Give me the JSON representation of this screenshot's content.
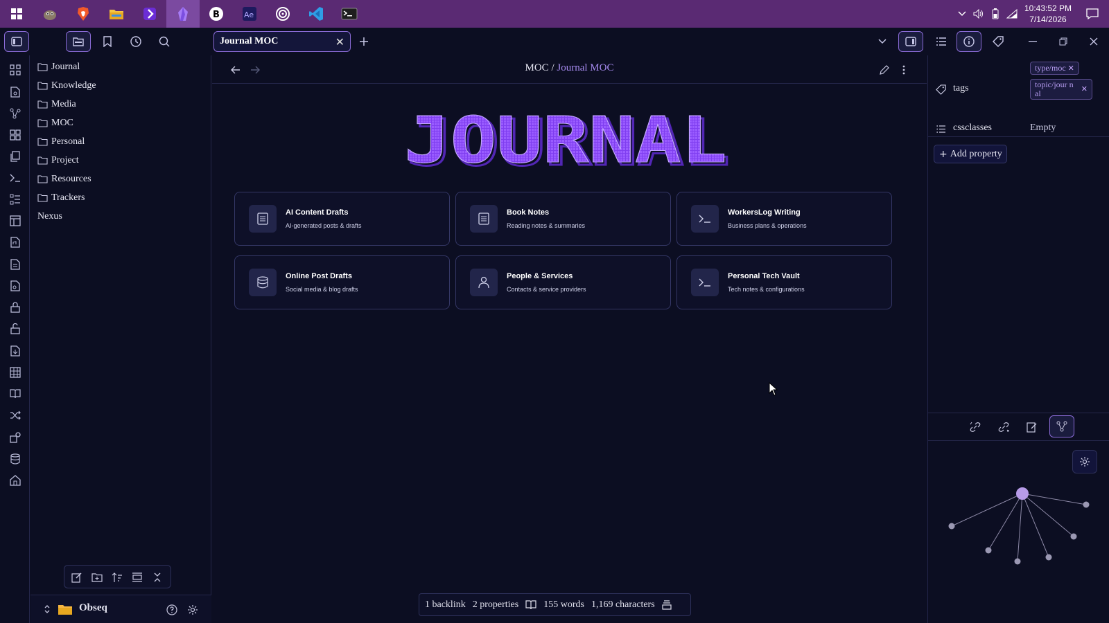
{
  "taskbar": {
    "time": "10:43:52 PM",
    "date": "7/14/2026"
  },
  "tab": {
    "title": "Journal MOC"
  },
  "breadcrumb": {
    "parent": "MOC",
    "sep": " / ",
    "current": "Journal MOC"
  },
  "files": [
    {
      "label": "Journal",
      "type": "folder"
    },
    {
      "label": "Knowledge",
      "type": "folder"
    },
    {
      "label": "Media",
      "type": "folder"
    },
    {
      "label": "MOC",
      "type": "folder"
    },
    {
      "label": "Personal",
      "type": "folder"
    },
    {
      "label": "Project",
      "type": "folder"
    },
    {
      "label": "Resources",
      "type": "folder"
    },
    {
      "label": "Trackers",
      "type": "folder"
    },
    {
      "label": "Nexus",
      "type": "file"
    }
  ],
  "vault": {
    "name": "Obseq"
  },
  "banner": {
    "text": "JOURNAL"
  },
  "cards": [
    {
      "title": "AI Content Drafts",
      "subtitle": "AI-generated posts & drafts",
      "icon": "doc-icon"
    },
    {
      "title": "Book Notes",
      "subtitle": "Reading notes & summaries",
      "icon": "doc-icon"
    },
    {
      "title": "WorkersLog Writing",
      "subtitle": "Business plans & operations",
      "icon": "terminal-icon"
    },
    {
      "title": "Online Post Drafts",
      "subtitle": "Social media & blog drafts",
      "icon": "database-icon"
    },
    {
      "title": "People & Services",
      "subtitle": "Contacts & service providers",
      "icon": "person-icon"
    },
    {
      "title": "Personal Tech Vault",
      "subtitle": "Tech notes & configurations",
      "icon": "terminal-icon"
    }
  ],
  "properties": {
    "tags_label": "tags",
    "tags": [
      "type/moc",
      "topic/jour nal"
    ],
    "cssclasses_label": "cssclasses",
    "cssclasses_value": "Empty",
    "add_label": "Add property"
  },
  "status": {
    "backlinks": "1 backlink",
    "properties": "2 properties",
    "words": "155 words",
    "characters": "1,169 characters"
  },
  "colors": {
    "accent": "#8a5cf0",
    "bg": "#0c0e22",
    "taskbar": "#5a2a73"
  }
}
